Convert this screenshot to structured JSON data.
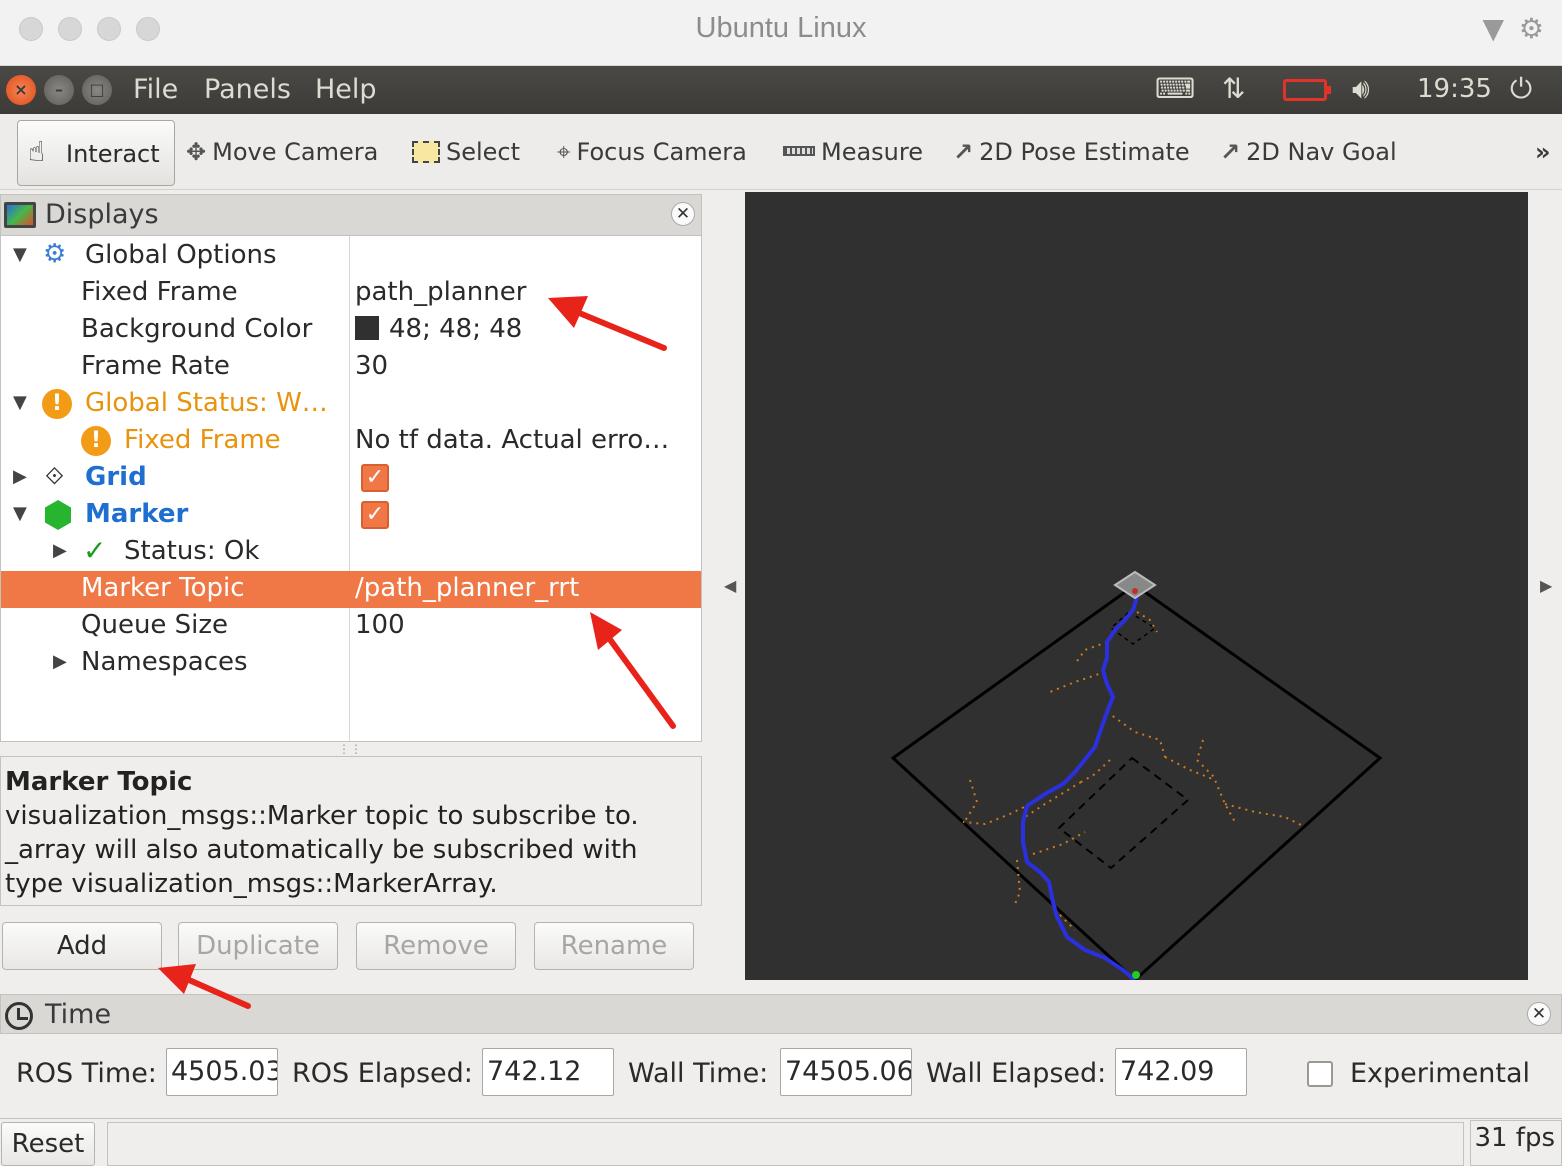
{
  "window": {
    "title": "Ubuntu Linux"
  },
  "menubar": {
    "items": [
      "File",
      "Panels",
      "Help"
    ],
    "clock": "19:35"
  },
  "toolbar": {
    "interact": "Interact",
    "move_camera": "Move Camera",
    "select": "Select",
    "focus_camera": "Focus Camera",
    "measure": "Measure",
    "pose_estimate": "2D Pose Estimate",
    "nav_goal": "2D Nav Goal",
    "overflow": "»"
  },
  "displays": {
    "title": "Displays",
    "rows": {
      "global_options": "Global Options",
      "fixed_frame": {
        "key": "Fixed Frame",
        "value": "path_planner"
      },
      "background_color": {
        "key": "Background Color",
        "value": "48; 48; 48",
        "swatch": "#303030"
      },
      "frame_rate": {
        "key": "Frame Rate",
        "value": "30"
      },
      "global_status": "Global Status: W…",
      "status_fixed_frame": {
        "key": "Fixed Frame",
        "value": "No tf data.  Actual erro…"
      },
      "grid": "Grid",
      "marker": "Marker",
      "status_ok": "Status: Ok",
      "marker_topic": {
        "key": "Marker Topic",
        "value": "/path_planner_rrt"
      },
      "queue_size": {
        "key": "Queue Size",
        "value": "100"
      },
      "namespaces": "Namespaces"
    },
    "checked": {
      "grid": true,
      "marker": true
    }
  },
  "description": {
    "title": "Marker Topic",
    "line1": "visualization_msgs::Marker topic to subscribe to.",
    "line2": "_array will also automatically be subscribed with",
    "line3": "type visualization_msgs::MarkerArray."
  },
  "buttons": {
    "add": "Add",
    "duplicate": "Duplicate",
    "remove": "Remove",
    "rename": "Rename"
  },
  "time": {
    "title": "Time",
    "ros_time_label": "ROS Time:",
    "ros_time": "4505.03",
    "ros_elapsed_label": "ROS Elapsed:",
    "ros_elapsed": "742.12",
    "wall_time_label": "Wall Time:",
    "wall_time": "74505.06",
    "wall_elapsed_label": "Wall Elapsed:",
    "wall_elapsed": "742.09",
    "experimental": "Experimental",
    "experimental_checked": false
  },
  "statusbar": {
    "reset": "Reset",
    "fps": "31 fps"
  },
  "colors": {
    "selection": "#f07846",
    "warning": "#f29b16",
    "link_blue": "#1e6fd0",
    "path": "#2a30e0",
    "tree_points": "#d07a1a",
    "annotation": "#e8231a"
  }
}
